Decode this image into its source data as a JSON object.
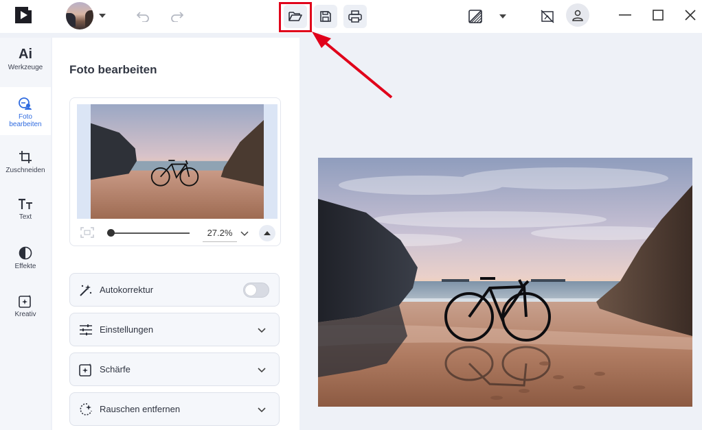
{
  "colors": {
    "accent": "#2f6be0",
    "highlight": "#e0001a",
    "panel_bg": "#ffffff",
    "canvas_bg": "#eef1f7"
  },
  "topbar": {
    "icons": [
      "app-logo-icon",
      "undo-icon",
      "redo-icon",
      "open-folder-icon",
      "save-icon",
      "print-icon",
      "compare-icon",
      "chevron-down-icon",
      "crop-off-icon",
      "user-icon",
      "minimize-icon",
      "maximize-icon",
      "close-icon"
    ]
  },
  "rail": {
    "items": [
      {
        "label": "Werkzeuge",
        "icon": "ai-icon",
        "glyph": "Ai"
      },
      {
        "label": "Foto bearbeiten",
        "icon": "photo-edit-icon"
      },
      {
        "label": "Zuschneiden",
        "icon": "crop-icon"
      },
      {
        "label": "Text",
        "icon": "text-icon"
      },
      {
        "label": "Effekte",
        "icon": "effects-icon"
      },
      {
        "label": "Kreativ",
        "icon": "creative-icon"
      }
    ]
  },
  "panel": {
    "title": "Foto bearbeiten",
    "zoom": "27.2%",
    "sections": [
      {
        "label": "Autokorrektur",
        "icon": "magic-wand-icon",
        "control": "toggle",
        "on": false
      },
      {
        "label": "Einstellungen",
        "icon": "sliders-icon",
        "control": "chevron"
      },
      {
        "label": "Schärfe",
        "icon": "sharpen-icon",
        "control": "chevron"
      },
      {
        "label": "Rauschen entfernen",
        "icon": "denoise-icon",
        "control": "chevron"
      }
    ]
  }
}
